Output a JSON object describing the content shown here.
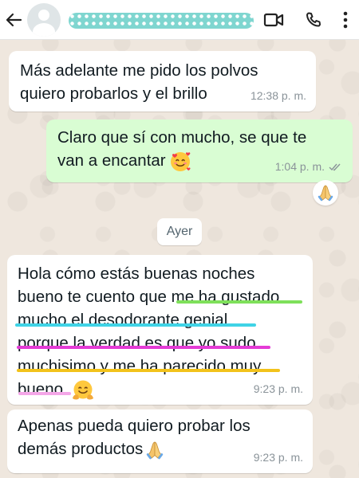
{
  "header": {
    "contact_name_hidden": "",
    "back_icon": "arrow-left-icon",
    "actions": [
      "video-call-icon",
      "phone-call-icon",
      "more-options-icon"
    ]
  },
  "messages": [
    {
      "direction": "incoming",
      "lines": [
        "Más adelante me pido los polvos",
        "quiero probarlos y el brillo"
      ],
      "time": "12:38 p. m."
    },
    {
      "direction": "outgoing",
      "lines": [
        "Claro que sí con mucho, se que te",
        "van a encantar"
      ],
      "emoji": "🥰",
      "time": "1:04 p. m.",
      "status": "read-double-check",
      "reaction": "🙏"
    },
    {
      "direction": "incoming",
      "lines": [
        "Hola cómo estás buenas noches",
        "bueno te cuento que me ha gustado",
        "mucho el desodorante genial",
        "porque la verdad es que yo sudo",
        "muchisimo y me ha parecido muy",
        "bueno."
      ],
      "emoji": "🤗",
      "time": "9:23 p. m."
    },
    {
      "direction": "incoming",
      "lines": [
        "Apenas pueda quiero probar los",
        "demás productos"
      ],
      "emoji": "🙏",
      "time": "9:23 p. m."
    }
  ],
  "date_separator": "Ayer",
  "colors": {
    "incoming_bubble": "#ffffff",
    "outgoing_bubble": "#d9fdd3",
    "wallpaper": "#efe7de",
    "highlight_green": "#7ee05a",
    "highlight_cyan": "#3fd3e6",
    "highlight_magenta": "#e43bd6",
    "highlight_yellow": "#f2c21b",
    "highlight_pink": "#f4a6e8"
  }
}
